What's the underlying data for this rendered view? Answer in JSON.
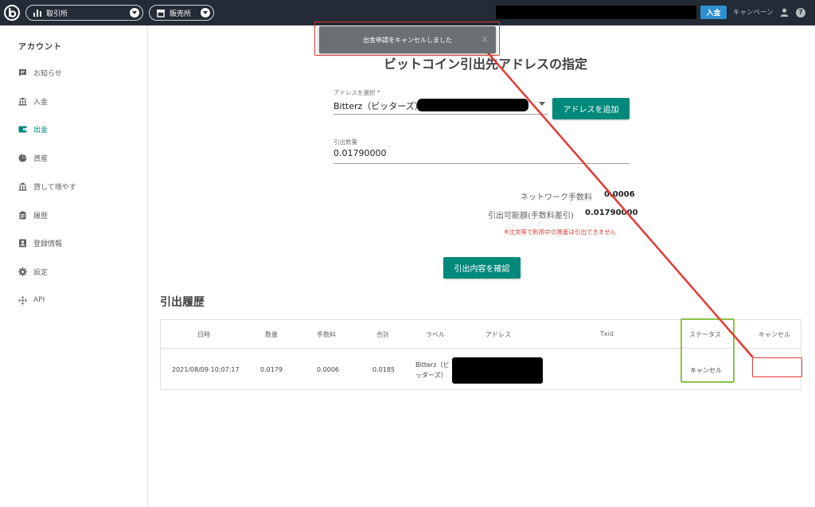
{
  "topbar": {
    "exchange_label": "取引所",
    "store_label": "販売所",
    "deposit_label": "入金",
    "campaign_label": "キャンペーン",
    "help_label": "?"
  },
  "sidebar": {
    "title": "アカウント",
    "items": [
      {
        "label": "お知らせ",
        "icon": "message-icon"
      },
      {
        "label": "入金",
        "icon": "bank-icon"
      },
      {
        "label": "出金",
        "icon": "wallet-icon",
        "active": true
      },
      {
        "label": "資産",
        "icon": "pie-chart-icon"
      },
      {
        "label": "貸して増やす",
        "icon": "bank-icon"
      },
      {
        "label": "履歴",
        "icon": "clipboard-icon"
      },
      {
        "label": "登録情報",
        "icon": "id-card-icon"
      },
      {
        "label": "設定",
        "icon": "gear-icon"
      },
      {
        "label": "API",
        "icon": "move-icon"
      }
    ]
  },
  "toast": {
    "message": "出金申請をキャンセルしました",
    "close": "×"
  },
  "withdraw": {
    "title": "ビットコイン引出先アドレスの指定",
    "address_label": "アドレスを選択 *",
    "address_value": "Bitterz（ビッターズ）",
    "add_address_button": "アドレスを追加",
    "amount_label": "引出数量",
    "amount_value": "0.01790000",
    "network_fee_label": "ネットワーク手数料",
    "network_fee_value": "0.0006",
    "available_label": "引出可能額(手数料差引)",
    "available_value": "0.01790000",
    "warning": "※注文等で利用中の資産は引出できません",
    "confirm_button": "引出内容を確認"
  },
  "history": {
    "title": "引出履歴",
    "columns": [
      "日時",
      "数量",
      "手数料",
      "合計",
      "ラベル",
      "アドレス",
      "Txid",
      "ステータス",
      "キャンセル"
    ],
    "rows": [
      {
        "datetime": "2021/08/09 10:07:17",
        "amount": "0.0179",
        "fee": "0.0006",
        "total": "0.0185",
        "label_line1": "Bitterz（ビ",
        "label_line2": "ッターズ）",
        "status": "キャンセル"
      }
    ]
  },
  "colors": {
    "topbar": "#232b36",
    "accent": "#00897b",
    "deposit": "#2f8fd1",
    "annotation_red": "#e53935",
    "annotation_green": "#8bc34a"
  }
}
